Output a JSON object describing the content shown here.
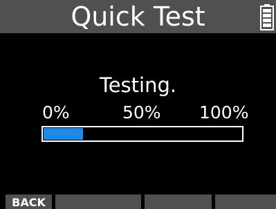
{
  "header": {
    "title": "Quick Test",
    "battery_icon": "battery-full-icon"
  },
  "main": {
    "status": "Testing.",
    "scale_labels": [
      "0%",
      "50%",
      "100%"
    ],
    "progress": {
      "fraction": 0.2,
      "fill_color": "#1a8ae8"
    }
  },
  "softkeys": [
    {
      "label": "BACK"
    },
    {
      "label": ""
    },
    {
      "label": ""
    },
    {
      "label": ""
    }
  ],
  "colors": {
    "background": "#000000",
    "bar": "#505050",
    "text": "#ffffff"
  }
}
